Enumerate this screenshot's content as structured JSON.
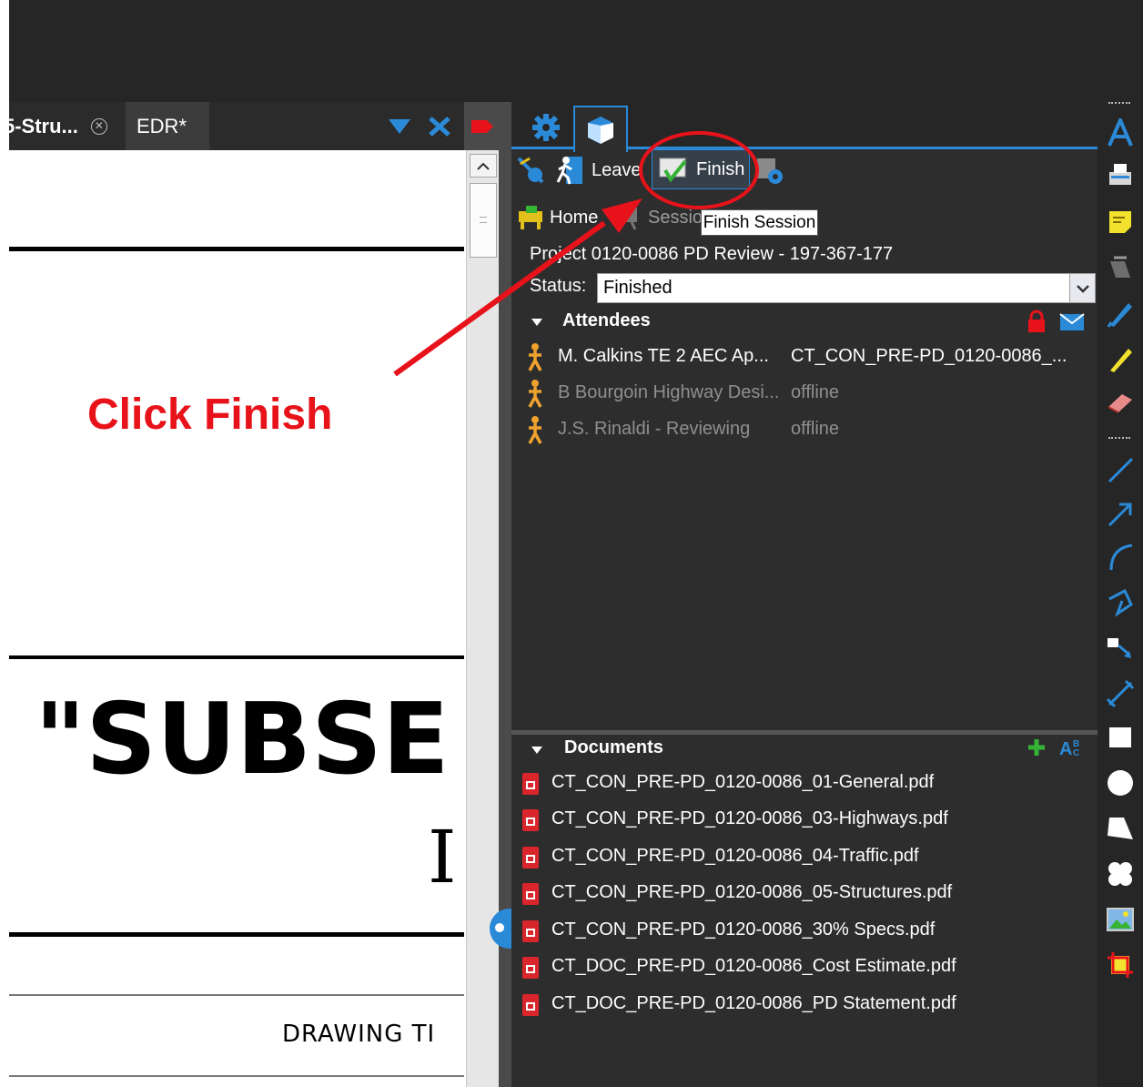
{
  "doc_tabs": [
    {
      "label": "5-Stru...",
      "closable": true
    },
    {
      "label": "EDR*",
      "active": true
    }
  ],
  "document": {
    "big_text": "\"SUBSE",
    "serif_text": "I",
    "drawing_title": "DRAWING  TI"
  },
  "annotation": {
    "label": "Click Finish",
    "color": "#e8131a"
  },
  "session": {
    "toolbar": {
      "leave_label": "Leave",
      "finish_label": "Finish",
      "tooltip": "Finish Session"
    },
    "nav": {
      "home_label": "Home",
      "session_label": "Sessio"
    },
    "project_title": "Project 0120-0086 PD Review - 197-367-177",
    "status_label": "Status:",
    "status_value": "Finished",
    "attendees": {
      "header": "Attendees",
      "items": [
        {
          "name": "M. Calkins TE 2 AEC Ap...",
          "status": "CT_CON_PRE-PD_0120-0086_...",
          "online": true
        },
        {
          "name": "B Bourgoin Highway Desi...",
          "status": "offline",
          "online": false
        },
        {
          "name": "J.S. Rinaldi - Reviewing",
          "status": "offline",
          "online": false
        }
      ]
    },
    "documents": {
      "header": "Documents",
      "items": [
        "CT_CON_PRE-PD_0120-0086_01-General.pdf",
        "CT_CON_PRE-PD_0120-0086_03-Highways.pdf",
        "CT_CON_PRE-PD_0120-0086_04-Traffic.pdf",
        "CT_CON_PRE-PD_0120-0086_05-Structures.pdf",
        "CT_CON_PRE-PD_0120-0086_30% Specs.pdf",
        "CT_DOC_PRE-PD_0120-0086_Cost Estimate.pdf",
        "CT_DOC_PRE-PD_0120-0086_PD Statement.pdf"
      ]
    }
  },
  "colors": {
    "accent_blue": "#2b8ad8",
    "attendee_orange": "#f0a22e",
    "offline_gray": "#8f8f8f",
    "pdf_red": "#d9262c"
  },
  "right_tools": [
    "text-icon",
    "typewriter-icon",
    "note-icon",
    "highlight-icon",
    "pen-icon",
    "highlighter-icon",
    "eraser-icon",
    "line-icon",
    "arrow-icon",
    "arc-icon",
    "polyline-icon",
    "callout-icon",
    "dimension-icon",
    "rectangle-icon",
    "ellipse-icon",
    "polygon-icon",
    "cloud-icon",
    "image-icon",
    "crop-icon"
  ]
}
